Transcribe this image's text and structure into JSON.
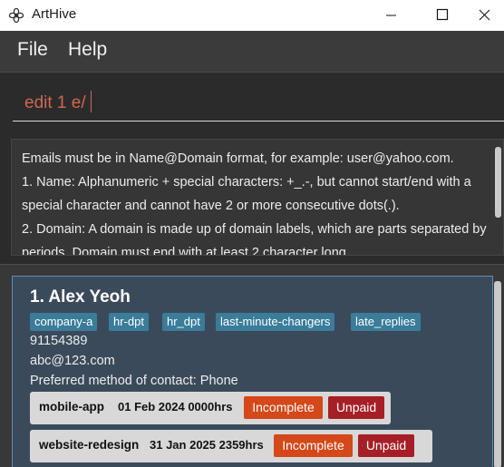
{
  "window": {
    "title": "ArtHive",
    "icons": {
      "app": "flower-icon",
      "minimize": "minimize-icon",
      "maximize": "maximize-icon",
      "close": "close-icon"
    }
  },
  "menu": {
    "file": "File",
    "help": "Help"
  },
  "command": {
    "value": "edit 1 e/"
  },
  "result": {
    "text": "Emails must be in Name@Domain format, for example: user@yahoo.com.\n1. Name: Alphanumeric + special characters: +_.-, but cannot start/end with a special character and cannot have 2 or more consecutive dots(.).\n2. Domain: A domain is made up of domain labels, which are parts separated by periods. Domain must end with at least 2 character long"
  },
  "persons": [
    {
      "name": "1. Alex Yeoh",
      "tags": [
        "company-a",
        "hr-dpt",
        "hr_dpt",
        "last-minute-changers",
        "late_replies"
      ],
      "phone": "91154389",
      "email": "abc@123.com",
      "preferred_contact": "Preferred method of contact: Phone",
      "projects": [
        {
          "name": "mobile-app",
          "date": "01 Feb 2024 0000hrs",
          "status": "Incomplete",
          "payment": "Unpaid"
        },
        {
          "name": "website-redesign",
          "date": "31 Jan 2025 2359hrs",
          "status": "Incomplete",
          "payment": "Unpaid"
        }
      ]
    }
  ],
  "colors": {
    "command_text": "#d06651",
    "tag_bg": "#3a7c99",
    "incomplete_bg": "#d4481a",
    "unpaid_bg": "#a61f26",
    "card_bg": "#3b4a5b",
    "card_border": "#5a8fb8"
  }
}
